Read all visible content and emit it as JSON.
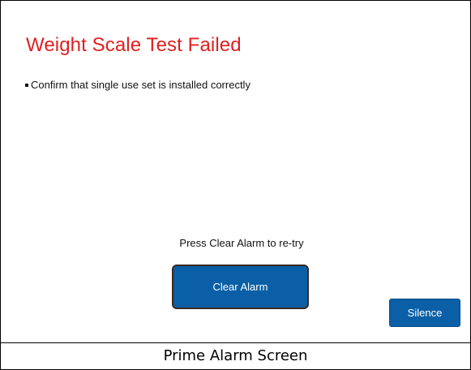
{
  "screen": {
    "title": "Weight Scale Test Failed",
    "instruction": "Confirm that single use set is installed correctly",
    "prompt": "Press Clear Alarm to re-try",
    "clear_button_label": "Clear Alarm",
    "silence_button_label": "Silence"
  },
  "caption": "Prime Alarm Screen",
  "colors": {
    "title": "#e02020",
    "button": "#0a5fa6",
    "button_border": "#3b2a20"
  }
}
